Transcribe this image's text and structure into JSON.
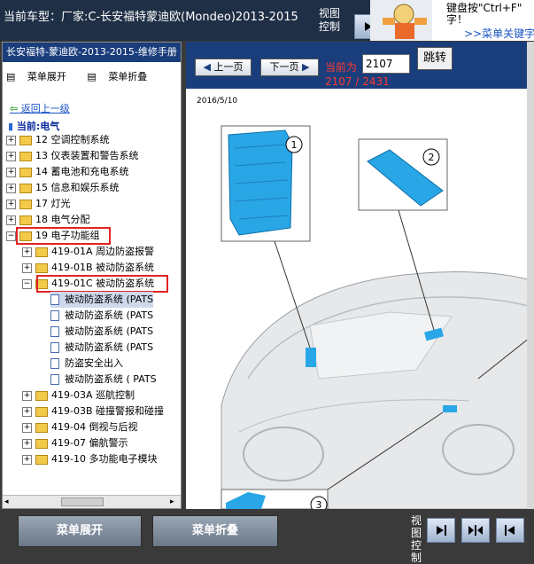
{
  "top": {
    "car_model": "当前车型：厂家:C-长安福特蒙迪欧(Mondeo)2013-2015",
    "view_control": "视图控制"
  },
  "ad": {
    "line1": "键盘按\"Ctrl+F\"",
    "line2": "字！",
    "link": ">>菜单关键字"
  },
  "left": {
    "manual_title": "长安福特-蒙迪欧-2013-2015-维修手册",
    "expand_label": "菜单展开",
    "collapse_label": "菜单折叠",
    "back_link": "返回上一级",
    "current": "当前:电气",
    "tree": [
      {
        "label": "12 空调控制系统",
        "type": "folder"
      },
      {
        "label": "13 仪表装置和警告系统",
        "type": "folder"
      },
      {
        "label": "14 蓄电池和充电系统",
        "type": "folder"
      },
      {
        "label": "15 信息和娱乐系统",
        "type": "folder"
      },
      {
        "label": "17 灯光",
        "type": "folder"
      },
      {
        "label": "18 电气分配",
        "type": "folder"
      },
      {
        "label": "19 电子功能组",
        "type": "folder-open"
      },
      {
        "label": "419-01A 周边防盗报警",
        "type": "sub"
      },
      {
        "label": "419-01B 被动防盗系统",
        "type": "sub"
      },
      {
        "label": "419-01C 被动防盗系统",
        "type": "sub-open"
      },
      {
        "label": "被动防盗系统 (PATS",
        "type": "doc"
      },
      {
        "label": "被动防盗系统 (PATS",
        "type": "doc"
      },
      {
        "label": "被动防盗系统 (PATS",
        "type": "doc"
      },
      {
        "label": "被动防盗系统 (PATS",
        "type": "doc"
      },
      {
        "label": "防盗安全出入",
        "type": "doc"
      },
      {
        "label": "被动防盗系统 ( PATS",
        "type": "doc"
      },
      {
        "label": "419-03A 巡航控制",
        "type": "sub"
      },
      {
        "label": "419-03B 碰撞警报和碰撞",
        "type": "sub"
      },
      {
        "label": "419-04 倒视与后视",
        "type": "sub"
      },
      {
        "label": "419-07 偏航警示",
        "type": "sub"
      },
      {
        "label": "419-10 多功能电子模块",
        "type": "sub"
      }
    ]
  },
  "right": {
    "prev_label": "上一页",
    "next_label": "下一页",
    "page_label": "当前为",
    "page_input": "2107",
    "jump_label": "跳转",
    "page_count": "2107 / 2431",
    "doc_date": "2016/5/10",
    "callouts": [
      "1",
      "2",
      "3"
    ]
  },
  "bottom": {
    "expand_label": "菜单展开",
    "collapse_label": "菜单折叠",
    "view_control": "视图控制"
  },
  "colors": {
    "header_bg": "#1f2f45",
    "nav_bg": "#1a3d7c",
    "page_text": "#ff3b30",
    "highlight_box": "#e12424",
    "module_blue": "#29a6e6"
  }
}
